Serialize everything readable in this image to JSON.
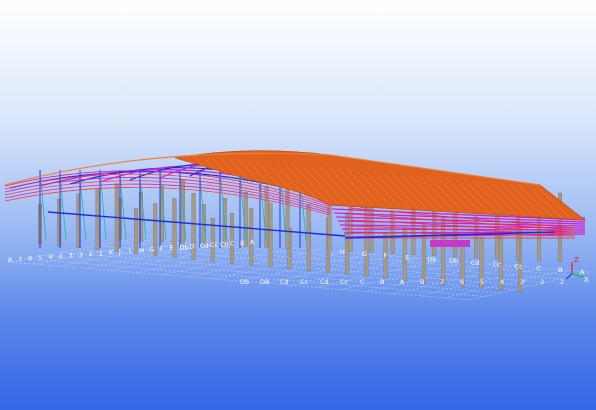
{
  "viewport": {
    "background_top": "#ffffff",
    "background_bottom": "#3566e6"
  },
  "model": {
    "colors": {
      "roof_deck": "#e0621e",
      "rafter": "#cc22cc",
      "purlin": "#1a2fd6",
      "column": "#a39a8c",
      "bracing": "#1fb8a8",
      "edge": "#f08030",
      "grid": "#c8d8ff"
    }
  },
  "grid_labels": {
    "left_row": [
      "8",
      "7",
      "6",
      "5",
      "4'",
      "4",
      "3'",
      "3",
      "2",
      "1",
      "K",
      "J",
      "I",
      "H",
      "G",
      "F",
      "E",
      "Db",
      "D",
      "Cd",
      "Cc",
      "Cb",
      "C",
      "B",
      "A"
    ],
    "front_row": [
      "Db",
      "DB",
      "Cd",
      "Cc",
      "Cd",
      "Cc",
      "C",
      "B",
      "A",
      "B",
      "7",
      "6",
      "5",
      "4",
      "3'",
      "3",
      "2"
    ],
    "right_row": [
      "H",
      "G",
      "F",
      "E",
      "Db",
      "Db",
      "Cd",
      "Cc",
      "Cc",
      "C",
      "B",
      "A"
    ]
  },
  "axes": {
    "z_label": "Z",
    "x_label": "X"
  }
}
